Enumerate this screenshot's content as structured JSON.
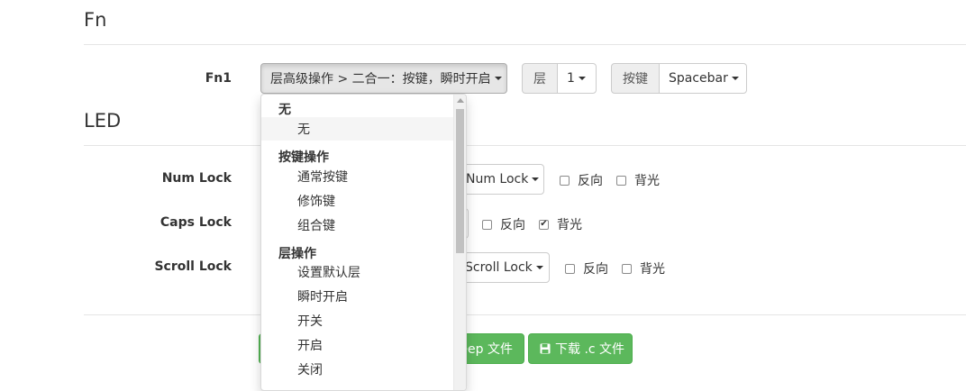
{
  "fn_section": {
    "title": "Fn",
    "fn1_label": "Fn1",
    "fn1_select": "层高级操作 > 二合一：按键，瞬时开启",
    "layer_addon": "层",
    "layer_value": "1",
    "key_addon": "按键",
    "key_value": "Spacebar"
  },
  "led_section": {
    "title": "LED",
    "rows": [
      {
        "label": "Num Lock",
        "select": "Num Lock",
        "invert": "反向",
        "backlight": "背光",
        "invert_checked": false,
        "backlight_checked": false
      },
      {
        "label": "Caps Lock",
        "select": "",
        "invert": "反向",
        "backlight": "背光",
        "invert_checked": false,
        "backlight_checked": true
      },
      {
        "label": "Scroll Lock",
        "select": "Scroll Lock",
        "invert": "反向",
        "backlight": "背光",
        "invert_checked": false,
        "backlight_checked": false
      }
    ]
  },
  "actions": {
    "eep_label": "eep 文件",
    "download_c_label": "下载 .c 文件"
  },
  "dropdown": {
    "groups": [
      {
        "header": "无",
        "items": [
          "无"
        ]
      },
      {
        "header": "按键操作",
        "items": [
          "通常按键",
          "修饰键",
          "组合键"
        ]
      },
      {
        "header": "层操作",
        "items": [
          "设置默认层",
          "瞬时开启",
          "开关",
          "开启",
          "关闭"
        ]
      }
    ],
    "selected": "无"
  },
  "colors": {
    "success": "#5cb85c",
    "border": "#cccccc"
  }
}
